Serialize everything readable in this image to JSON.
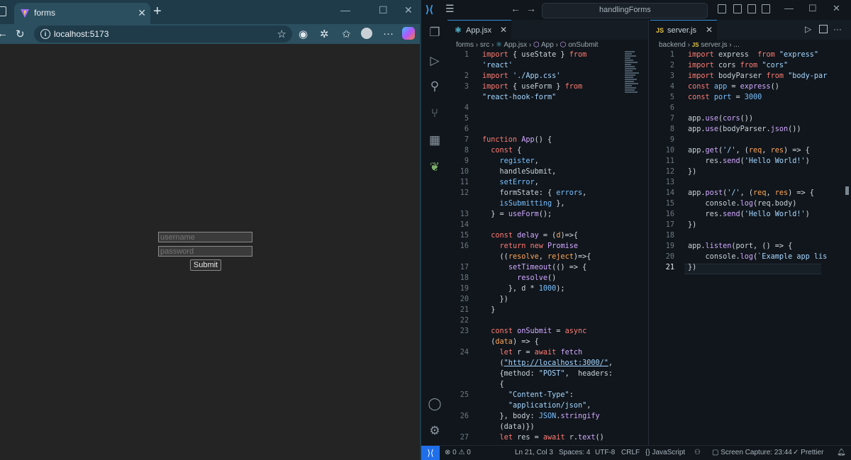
{
  "browser": {
    "tab_title": "forms",
    "url": "localhost:5173",
    "form": {
      "username_placeholder": "username",
      "password_placeholder": "password",
      "submit_label": "Submit"
    }
  },
  "vscode": {
    "search_text": "handlingForms",
    "left_editor": {
      "tab_label": "App.jsx",
      "breadcrumb": [
        "forms",
        "src",
        "App.jsx",
        "App",
        "onSubmit"
      ],
      "line_numbers": [
        "1",
        "",
        "2",
        "3",
        "",
        "4",
        "5",
        "6",
        "7",
        "8",
        "9",
        "10",
        "11",
        "12",
        "",
        "13",
        "14",
        "15",
        "16",
        "",
        "17",
        "18",
        "19",
        "20",
        "21",
        "22",
        "23",
        "",
        "24",
        "",
        "",
        "",
        "25",
        "",
        "26",
        "",
        "27"
      ]
    },
    "right_editor": {
      "tab_label": "server.js",
      "breadcrumb": [
        "backend",
        "server.js",
        "..."
      ],
      "line_numbers": [
        "1",
        "2",
        "3",
        "4",
        "5",
        "6",
        "7",
        "8",
        "9",
        "10",
        "11",
        "12",
        "13",
        "14",
        "15",
        "16",
        "17",
        "18",
        "19",
        "20",
        "21"
      ]
    },
    "status": {
      "errors": "0",
      "warnings": "0",
      "cursor": "Ln 21, Col 3",
      "spaces": "Spaces: 4",
      "encoding": "UTF-8",
      "eol": "CRLF",
      "language": "JavaScript",
      "screen_capture": "Screen Capture: 23:44",
      "prettier": "Prettier"
    }
  },
  "colors": {
    "browser_chrome": "#2b4f5f",
    "page_bg": "#242424",
    "editor_bg": "#10161c",
    "accent": "#1f6feb"
  }
}
